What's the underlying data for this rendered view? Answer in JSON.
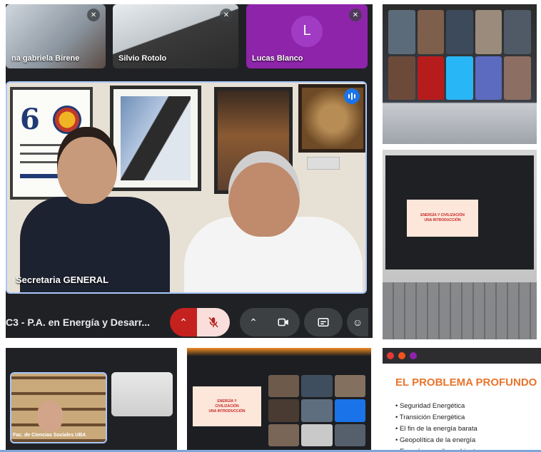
{
  "meet": {
    "participants": [
      {
        "name": "na gabriela Birene",
        "muted": true
      },
      {
        "name": "Silvio Rotolo",
        "muted": true
      },
      {
        "name": "Lucas Blanco",
        "avatar_letter": "L",
        "muted": true,
        "tile_color": "#8e24aa"
      }
    ],
    "main_tile": {
      "name": "Secretaria GENERAL",
      "speaking": true
    },
    "poster": {
      "number": "6"
    },
    "meeting_title": "C3 - P.A. en Energía y Desarr...",
    "controls": {
      "mic_state": "muted",
      "camera_state": "on"
    },
    "colors": {
      "background": "#202124",
      "mic_off": "#c5221f",
      "accent": "#1a73e8",
      "active_border": "#a8c7fa"
    }
  },
  "photo_slides": {
    "laptop_slide_lines": [
      "ENERGÍA Y CIVILIZACIÓN",
      "UNA INTRODUCCIÓN"
    ],
    "bottom_slide_lines": [
      "ENERGÍA Y",
      "CIVILIZACIÓN",
      "UNA INTRODUCCIÓN"
    ],
    "bottom_left_caption": "Fac. de Ciencias Sociales UBA"
  },
  "slide_closeup": {
    "title": "EL PROBLEMA PROFUNDO",
    "bullets": [
      "Seguridad Energética",
      "Transición Energética",
      "El fin de la energía barata",
      "Geopolítica de la energía",
      "Energía y medio ambiente"
    ],
    "title_color": "#e8742c"
  }
}
